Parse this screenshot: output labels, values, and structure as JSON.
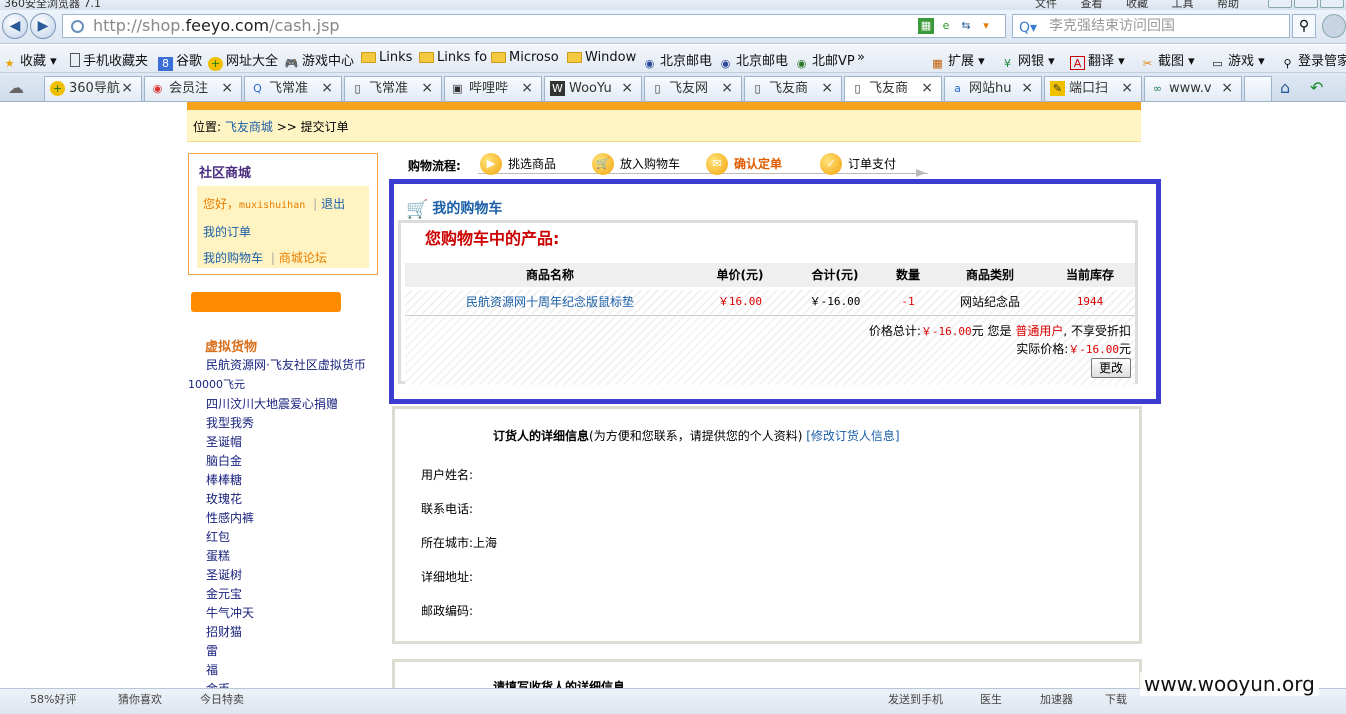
{
  "browser": {
    "window_title": "360安全浏览器 7.1",
    "menu": [
      "文件",
      "查看",
      "收藏",
      "工具",
      "帮助"
    ],
    "url_prefix": "http://shop.",
    "url_host": "feeyo.com",
    "url_path": "/cash.jsp",
    "search_placeholder": "李克强结束访问回国",
    "favorites": [
      {
        "label": "收藏",
        "icon": "star-icon"
      },
      {
        "label": "手机收藏夹",
        "icon": "phone-icon"
      },
      {
        "label": "谷歌",
        "icon": "google-icon"
      },
      {
        "label": "网址大全",
        "icon": "360-icon"
      },
      {
        "label": "游戏中心",
        "icon": "gamepad-icon"
      },
      {
        "label": "Links",
        "icon": "folder-icon"
      },
      {
        "label": "Links fo",
        "icon": "folder-icon"
      },
      {
        "label": "Microso",
        "icon": "folder-icon"
      },
      {
        "label": "Window",
        "icon": "folder-icon"
      },
      {
        "label": "北京邮电",
        "icon": "site-icon"
      },
      {
        "label": "北京邮电",
        "icon": "site-icon"
      },
      {
        "label": "北邮VP",
        "icon": "site-icon"
      }
    ],
    "fav_more": "»",
    "fav_right": [
      {
        "label": "扩展",
        "icon": "grid-icon"
      },
      {
        "label": "网银",
        "icon": "bank-icon"
      },
      {
        "label": "翻译",
        "icon": "translate-icon"
      },
      {
        "label": "截图",
        "icon": "scissors-icon"
      },
      {
        "label": "游戏",
        "icon": "gamepad-icon"
      },
      {
        "label": "登录管家",
        "icon": "key-icon"
      }
    ],
    "tabs": [
      {
        "label": "360导航",
        "icon": "360-icon"
      },
      {
        "label": "会员注",
        "icon": "chrome-icon"
      },
      {
        "label": "飞常准",
        "icon": "search-icon"
      },
      {
        "label": "飞常准",
        "icon": "page-icon"
      },
      {
        "label": "哔哩哔",
        "icon": "tv-icon"
      },
      {
        "label": "WooYu",
        "icon": "wooyun-icon"
      },
      {
        "label": "飞友网",
        "icon": "page-icon"
      },
      {
        "label": "飞友商",
        "icon": "page-icon"
      },
      {
        "label": "飞友商",
        "icon": "page-icon"
      },
      {
        "label": "网站hu",
        "icon": "a-icon"
      },
      {
        "label": "端口扫",
        "icon": "note-icon"
      },
      {
        "label": "www.v",
        "icon": "link-icon"
      }
    ]
  },
  "page": {
    "breadcrumb": {
      "prefix": "位置:",
      "home": "飞友商城",
      "sep": ">>",
      "current": "提交订单"
    },
    "sidebar": {
      "title": "社区商城",
      "greeting": "您好，",
      "username": "muxishuihan",
      "sep": "|",
      "logout": "退出",
      "my_orders": "我的订单",
      "my_cart": "我的购物车",
      "forum": "商城论坛",
      "category_title": "虚拟货物",
      "categories": [
        "民航资源网·飞友社区虚拟货币",
        "10000飞元",
        "四川汶川大地震爱心捐赠",
        "我型我秀",
        "圣诞帽",
        "脑白金",
        "棒棒糖",
        "玫瑰花",
        "性感内裤",
        "红包",
        "蛋糕",
        "圣诞树",
        "金元宝",
        "牛气冲天",
        "招财猫",
        "雷",
        "福",
        "金币"
      ]
    },
    "flow": {
      "label": "购物流程:",
      "steps": [
        "挑选商品",
        "放入购物车",
        "确认定单",
        "订单支付"
      ],
      "current_index": 2
    },
    "cart": {
      "title": "我的购物车",
      "products_heading": "您购物车中的产品:",
      "columns": [
        "商品名称",
        "单价(元)",
        "合计(元)",
        "数量",
        "商品类别",
        "当前库存"
      ],
      "rows": [
        {
          "name": "民航资源网十周年纪念版鼠标垫",
          "unit_price": "￥16.00",
          "total": "￥-16.00",
          "qty": "-1",
          "category": "网站纪念品",
          "stock": "1944"
        }
      ],
      "total_label": "价格总计:",
      "total_value": "￥-16.00",
      "total_unit": "元",
      "you_are": "您是",
      "user_type": "普通用户",
      "no_discount": ", 不享受折扣",
      "actual_label": "实际价格:",
      "actual_value": "￥-16.00",
      "actual_unit": "元",
      "change_button": "更改"
    },
    "orderer": {
      "title": "订货人的详细信息",
      "hint": "(为方便和您联系，请提供您的个人资料)",
      "edit_link": "[修改订货人信息]",
      "fields": {
        "name_label": "用户姓名:",
        "phone_label": "联系电话:",
        "city_label": "所在城市:",
        "city_value": "上海",
        "address_label": "详细地址:",
        "zip_label": "邮政编码:"
      }
    },
    "receiver": {
      "title": "请填写收货人的详细信息"
    }
  },
  "statusbar": [
    "58%好评",
    "猜你喜欢",
    "今日特卖",
    "发送到手机",
    "医生",
    "加速器",
    "下载"
  ],
  "watermark": "www.wooyun.org"
}
